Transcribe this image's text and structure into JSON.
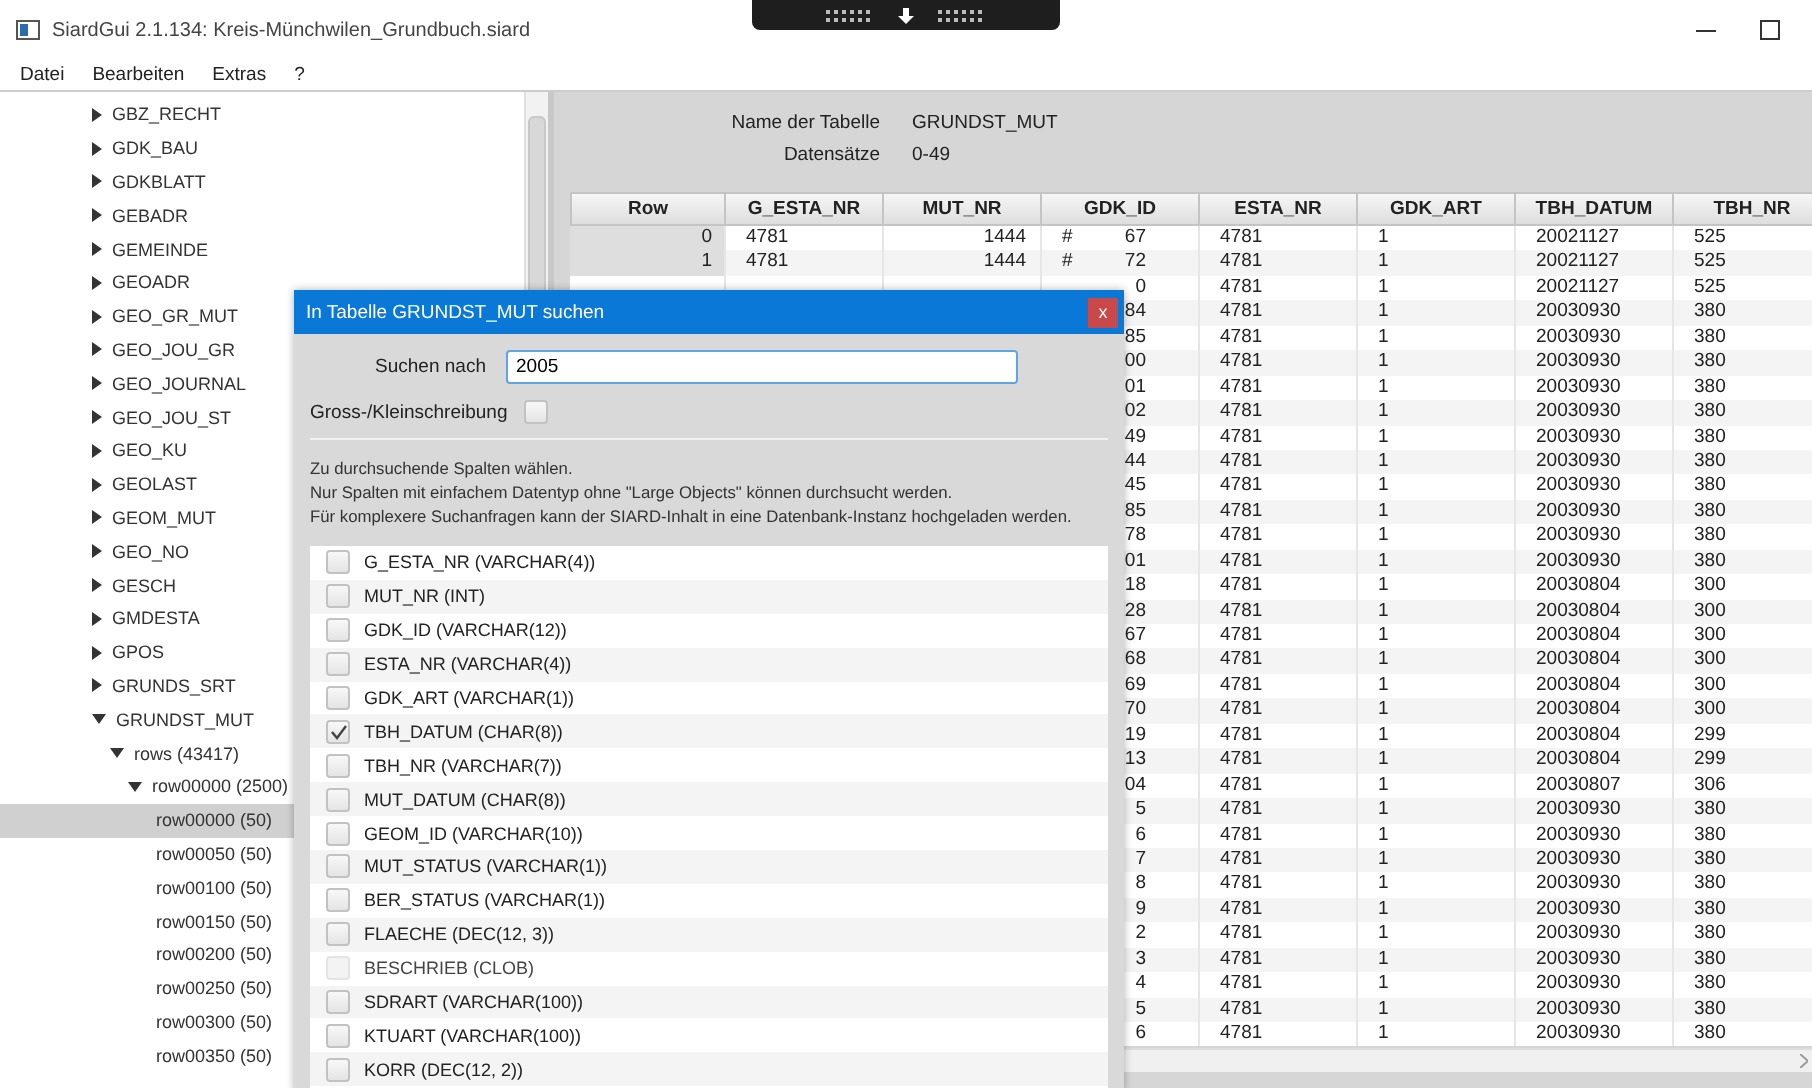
{
  "window": {
    "title": "SiardGui 2.1.134: Kreis-Münchwilen_Grundbuch.siard"
  },
  "menu": [
    "Datei",
    "Bearbeiten",
    "Extras",
    "?"
  ],
  "tree": [
    {
      "label": "GBZ_RECHT",
      "expanded": false,
      "selected": false
    },
    {
      "label": "GDK_BAU",
      "expanded": false,
      "selected": false
    },
    {
      "label": "GDKBLATT",
      "expanded": false,
      "selected": false
    },
    {
      "label": "GEBADR",
      "expanded": false,
      "selected": false
    },
    {
      "label": "GEMEINDE",
      "expanded": false,
      "selected": false
    },
    {
      "label": "GEOADR",
      "expanded": false,
      "selected": false
    },
    {
      "label": "GEO_GR_MUT",
      "expanded": false,
      "selected": false
    },
    {
      "label": "GEO_JOU_GR",
      "expanded": false,
      "selected": false
    },
    {
      "label": "GEO_JOURNAL",
      "expanded": false,
      "selected": false
    },
    {
      "label": "GEO_JOU_ST",
      "expanded": false,
      "selected": false
    },
    {
      "label": "GEO_KU",
      "expanded": false,
      "selected": false
    },
    {
      "label": "GEOLAST",
      "expanded": false,
      "selected": false
    },
    {
      "label": "GEOM_MUT",
      "expanded": false,
      "selected": false
    },
    {
      "label": "GEO_NO",
      "expanded": false,
      "selected": false
    },
    {
      "label": "GESCH",
      "expanded": false,
      "selected": false
    },
    {
      "label": "GMDESTA",
      "expanded": false,
      "selected": false
    },
    {
      "label": "GPOS",
      "expanded": false,
      "selected": false
    },
    {
      "label": "GRUNDS_SRT",
      "expanded": false,
      "selected": false
    },
    {
      "label": "GRUNDST_MUT",
      "expanded": true,
      "selected": false,
      "children": [
        {
          "label": "rows (43417)",
          "expanded": true,
          "selected": false,
          "children": [
            {
              "label": "row00000 (2500)",
              "expanded": true,
              "selected": false,
              "children": [
                {
                  "label": "row00000 (50)",
                  "selected": true
                },
                {
                  "label": "row00050 (50)",
                  "selected": false
                },
                {
                  "label": "row00100 (50)",
                  "selected": false
                },
                {
                  "label": "row00150 (50)",
                  "selected": false
                },
                {
                  "label": "row00200 (50)",
                  "selected": false
                },
                {
                  "label": "row00250 (50)",
                  "selected": false
                },
                {
                  "label": "row00300 (50)",
                  "selected": false
                },
                {
                  "label": "row00350 (50)",
                  "selected": false
                }
              ]
            }
          ]
        }
      ]
    }
  ],
  "table_info": {
    "name_label": "Name der Tabelle",
    "name": "GRUNDST_MUT",
    "records_label": "Datensätze",
    "records": "0-49"
  },
  "table": {
    "columns": [
      "Row",
      "G_ESTA_NR",
      "MUT_NR",
      "GDK_ID",
      "ESTA_NR",
      "GDK_ART",
      "TBH_DATUM",
      "TBH_NR"
    ],
    "rows": [
      {
        "row": "0",
        "g_esta_nr": "4781",
        "mut_nr": "1444",
        "gdk_prefix": "#",
        "gdk_id": "67",
        "esta_nr": "4781",
        "gdk_art": "1",
        "tbh_datum": "20021127",
        "tbh_nr": "525"
      },
      {
        "row": "1",
        "g_esta_nr": "4781",
        "mut_nr": "1444",
        "gdk_prefix": "#",
        "gdk_id": "72",
        "esta_nr": "4781",
        "gdk_art": "1",
        "tbh_datum": "20021127",
        "tbh_nr": "525"
      },
      {
        "gdk_id": "0",
        "esta_nr": "4781",
        "gdk_art": "1",
        "tbh_datum": "20021127",
        "tbh_nr": "525"
      },
      {
        "gdk_id": "84",
        "esta_nr": "4781",
        "gdk_art": "1",
        "tbh_datum": "20030930",
        "tbh_nr": "380"
      },
      {
        "gdk_id": "85",
        "esta_nr": "4781",
        "gdk_art": "1",
        "tbh_datum": "20030930",
        "tbh_nr": "380"
      },
      {
        "gdk_id": "00",
        "esta_nr": "4781",
        "gdk_art": "1",
        "tbh_datum": "20030930",
        "tbh_nr": "380"
      },
      {
        "gdk_id": "01",
        "esta_nr": "4781",
        "gdk_art": "1",
        "tbh_datum": "20030930",
        "tbh_nr": "380"
      },
      {
        "gdk_id": "02",
        "esta_nr": "4781",
        "gdk_art": "1",
        "tbh_datum": "20030930",
        "tbh_nr": "380"
      },
      {
        "gdk_id": "49",
        "esta_nr": "4781",
        "gdk_art": "1",
        "tbh_datum": "20030930",
        "tbh_nr": "380"
      },
      {
        "gdk_id": "44",
        "esta_nr": "4781",
        "gdk_art": "1",
        "tbh_datum": "20030930",
        "tbh_nr": "380"
      },
      {
        "gdk_id": "45",
        "esta_nr": "4781",
        "gdk_art": "1",
        "tbh_datum": "20030930",
        "tbh_nr": "380"
      },
      {
        "gdk_id": "85",
        "esta_nr": "4781",
        "gdk_art": "1",
        "tbh_datum": "20030930",
        "tbh_nr": "380"
      },
      {
        "gdk_id": "78",
        "esta_nr": "4781",
        "gdk_art": "1",
        "tbh_datum": "20030930",
        "tbh_nr": "380"
      },
      {
        "gdk_id": "01",
        "esta_nr": "4781",
        "gdk_art": "1",
        "tbh_datum": "20030930",
        "tbh_nr": "380"
      },
      {
        "gdk_id": "18",
        "esta_nr": "4781",
        "gdk_art": "1",
        "tbh_datum": "20030804",
        "tbh_nr": "300"
      },
      {
        "gdk_id": "28",
        "esta_nr": "4781",
        "gdk_art": "1",
        "tbh_datum": "20030804",
        "tbh_nr": "300"
      },
      {
        "gdk_id": "67",
        "esta_nr": "4781",
        "gdk_art": "1",
        "tbh_datum": "20030804",
        "tbh_nr": "300"
      },
      {
        "gdk_id": "68",
        "esta_nr": "4781",
        "gdk_art": "1",
        "tbh_datum": "20030804",
        "tbh_nr": "300"
      },
      {
        "gdk_id": "69",
        "esta_nr": "4781",
        "gdk_art": "1",
        "tbh_datum": "20030804",
        "tbh_nr": "300"
      },
      {
        "gdk_id": "70",
        "esta_nr": "4781",
        "gdk_art": "1",
        "tbh_datum": "20030804",
        "tbh_nr": "300"
      },
      {
        "gdk_id": "19",
        "esta_nr": "4781",
        "gdk_art": "1",
        "tbh_datum": "20030804",
        "tbh_nr": "299"
      },
      {
        "gdk_id": "13",
        "esta_nr": "4781",
        "gdk_art": "1",
        "tbh_datum": "20030804",
        "tbh_nr": "299"
      },
      {
        "gdk_id": "04",
        "esta_nr": "4781",
        "gdk_art": "1",
        "tbh_datum": "20030807",
        "tbh_nr": "306"
      },
      {
        "gdk_id": "5",
        "esta_nr": "4781",
        "gdk_art": "1",
        "tbh_datum": "20030930",
        "tbh_nr": "380"
      },
      {
        "gdk_id": "6",
        "esta_nr": "4781",
        "gdk_art": "1",
        "tbh_datum": "20030930",
        "tbh_nr": "380"
      },
      {
        "gdk_id": "7",
        "esta_nr": "4781",
        "gdk_art": "1",
        "tbh_datum": "20030930",
        "tbh_nr": "380"
      },
      {
        "gdk_id": "8",
        "esta_nr": "4781",
        "gdk_art": "1",
        "tbh_datum": "20030930",
        "tbh_nr": "380"
      },
      {
        "gdk_id": "9",
        "esta_nr": "4781",
        "gdk_art": "1",
        "tbh_datum": "20030930",
        "tbh_nr": "380"
      },
      {
        "gdk_id": "2",
        "esta_nr": "4781",
        "gdk_art": "1",
        "tbh_datum": "20030930",
        "tbh_nr": "380"
      },
      {
        "gdk_id": "3",
        "esta_nr": "4781",
        "gdk_art": "1",
        "tbh_datum": "20030930",
        "tbh_nr": "380"
      },
      {
        "gdk_id": "4",
        "esta_nr": "4781",
        "gdk_art": "1",
        "tbh_datum": "20030930",
        "tbh_nr": "380"
      },
      {
        "gdk_id": "5",
        "esta_nr": "4781",
        "gdk_art": "1",
        "tbh_datum": "20030930",
        "tbh_nr": "380"
      },
      {
        "gdk_id": "6",
        "esta_nr": "4781",
        "gdk_art": "1",
        "tbh_datum": "20030930",
        "tbh_nr": "380"
      }
    ]
  },
  "dialog": {
    "title": "In Tabelle GRUNDST_MUT suchen",
    "close": "x",
    "search_label": "Suchen nach",
    "search_value": "2005",
    "case_label": "Gross-/Kleinschreibung",
    "case_checked": false,
    "instructions": [
      "Zu durchsuchende Spalten wählen.",
      "Nur Spalten mit einfachem Datentyp ohne \"Large Objects\" können durchsucht werden.",
      "Für komplexere Suchanfragen kann der SIARD-Inhalt in eine Datenbank-Instanz hochgeladen werden."
    ],
    "columns": [
      {
        "label": "G_ESTA_NR (VARCHAR(4))",
        "checked": false,
        "disabled": false
      },
      {
        "label": "MUT_NR (INT)",
        "checked": false,
        "disabled": false
      },
      {
        "label": "GDK_ID (VARCHAR(12))",
        "checked": false,
        "disabled": false
      },
      {
        "label": "ESTA_NR (VARCHAR(4))",
        "checked": false,
        "disabled": false
      },
      {
        "label": "GDK_ART (VARCHAR(1))",
        "checked": false,
        "disabled": false
      },
      {
        "label": "TBH_DATUM (CHAR(8))",
        "checked": true,
        "disabled": false
      },
      {
        "label": "TBH_NR (VARCHAR(7))",
        "checked": false,
        "disabled": false
      },
      {
        "label": "MUT_DATUM (CHAR(8))",
        "checked": false,
        "disabled": false
      },
      {
        "label": "GEOM_ID (VARCHAR(10))",
        "checked": false,
        "disabled": false
      },
      {
        "label": "MUT_STATUS (VARCHAR(1))",
        "checked": false,
        "disabled": false
      },
      {
        "label": "BER_STATUS (VARCHAR(1))",
        "checked": false,
        "disabled": false
      },
      {
        "label": "FLAECHE (DEC(12, 3))",
        "checked": false,
        "disabled": false
      },
      {
        "label": "BESCHRIEB (CLOB)",
        "checked": false,
        "disabled": true
      },
      {
        "label": "SDRART (VARCHAR(100))",
        "checked": false,
        "disabled": false
      },
      {
        "label": "KTUART (VARCHAR(100))",
        "checked": false,
        "disabled": false
      },
      {
        "label": "KORR (DEC(12, 2))",
        "checked": false,
        "disabled": false
      }
    ]
  }
}
